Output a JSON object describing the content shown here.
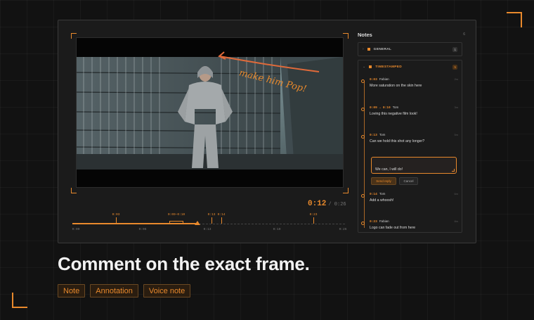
{
  "player": {
    "current_time": "0:12",
    "total_time": "/ 0:26",
    "annotation": "make him Pop!"
  },
  "timeline": {
    "markers": [
      {
        "label": "0:03"
      },
      {
        "label": "0:09–0:10"
      },
      {
        "label": "0:13"
      },
      {
        "label": "0:14"
      },
      {
        "label": "0:23"
      }
    ],
    "ticks": [
      "0:00",
      "0:06",
      "0:13",
      "0:19",
      "0:26"
    ],
    "progress": 0.46
  },
  "notes": {
    "title": "Notes",
    "count": "6",
    "general": {
      "label": "GENERAL",
      "count": "1"
    },
    "timestamped": {
      "label": "TIMESTAMPED",
      "count": "5"
    },
    "items": [
      {
        "time": "0:03",
        "author": "Fabian",
        "ago": "2m",
        "text": "More saturation on the skin here"
      },
      {
        "time": "0:09 → 0:10",
        "author": "Tom",
        "ago": "3m",
        "text": "Loving this negative film look!"
      },
      {
        "time": "0:13",
        "author": "Tom",
        "ago": "5m",
        "text": "Can we hold this shot any longer?"
      },
      {
        "time": "0:14",
        "author": "Tom",
        "ago": "6m",
        "text": "Add a whoosh!"
      },
      {
        "time": "0:23",
        "author": "Fabian",
        "ago": "8m",
        "text": "Logo can fade out from here"
      }
    ],
    "reply_value": "We can, I will do!",
    "send_label": "Send reply",
    "cancel_label": "Cancel"
  },
  "headline": "Comment on the exact frame.",
  "tags": [
    "Note",
    "Annotation",
    "Voice note"
  ],
  "colors": {
    "accent": "#e8892c",
    "background": "#121212"
  }
}
